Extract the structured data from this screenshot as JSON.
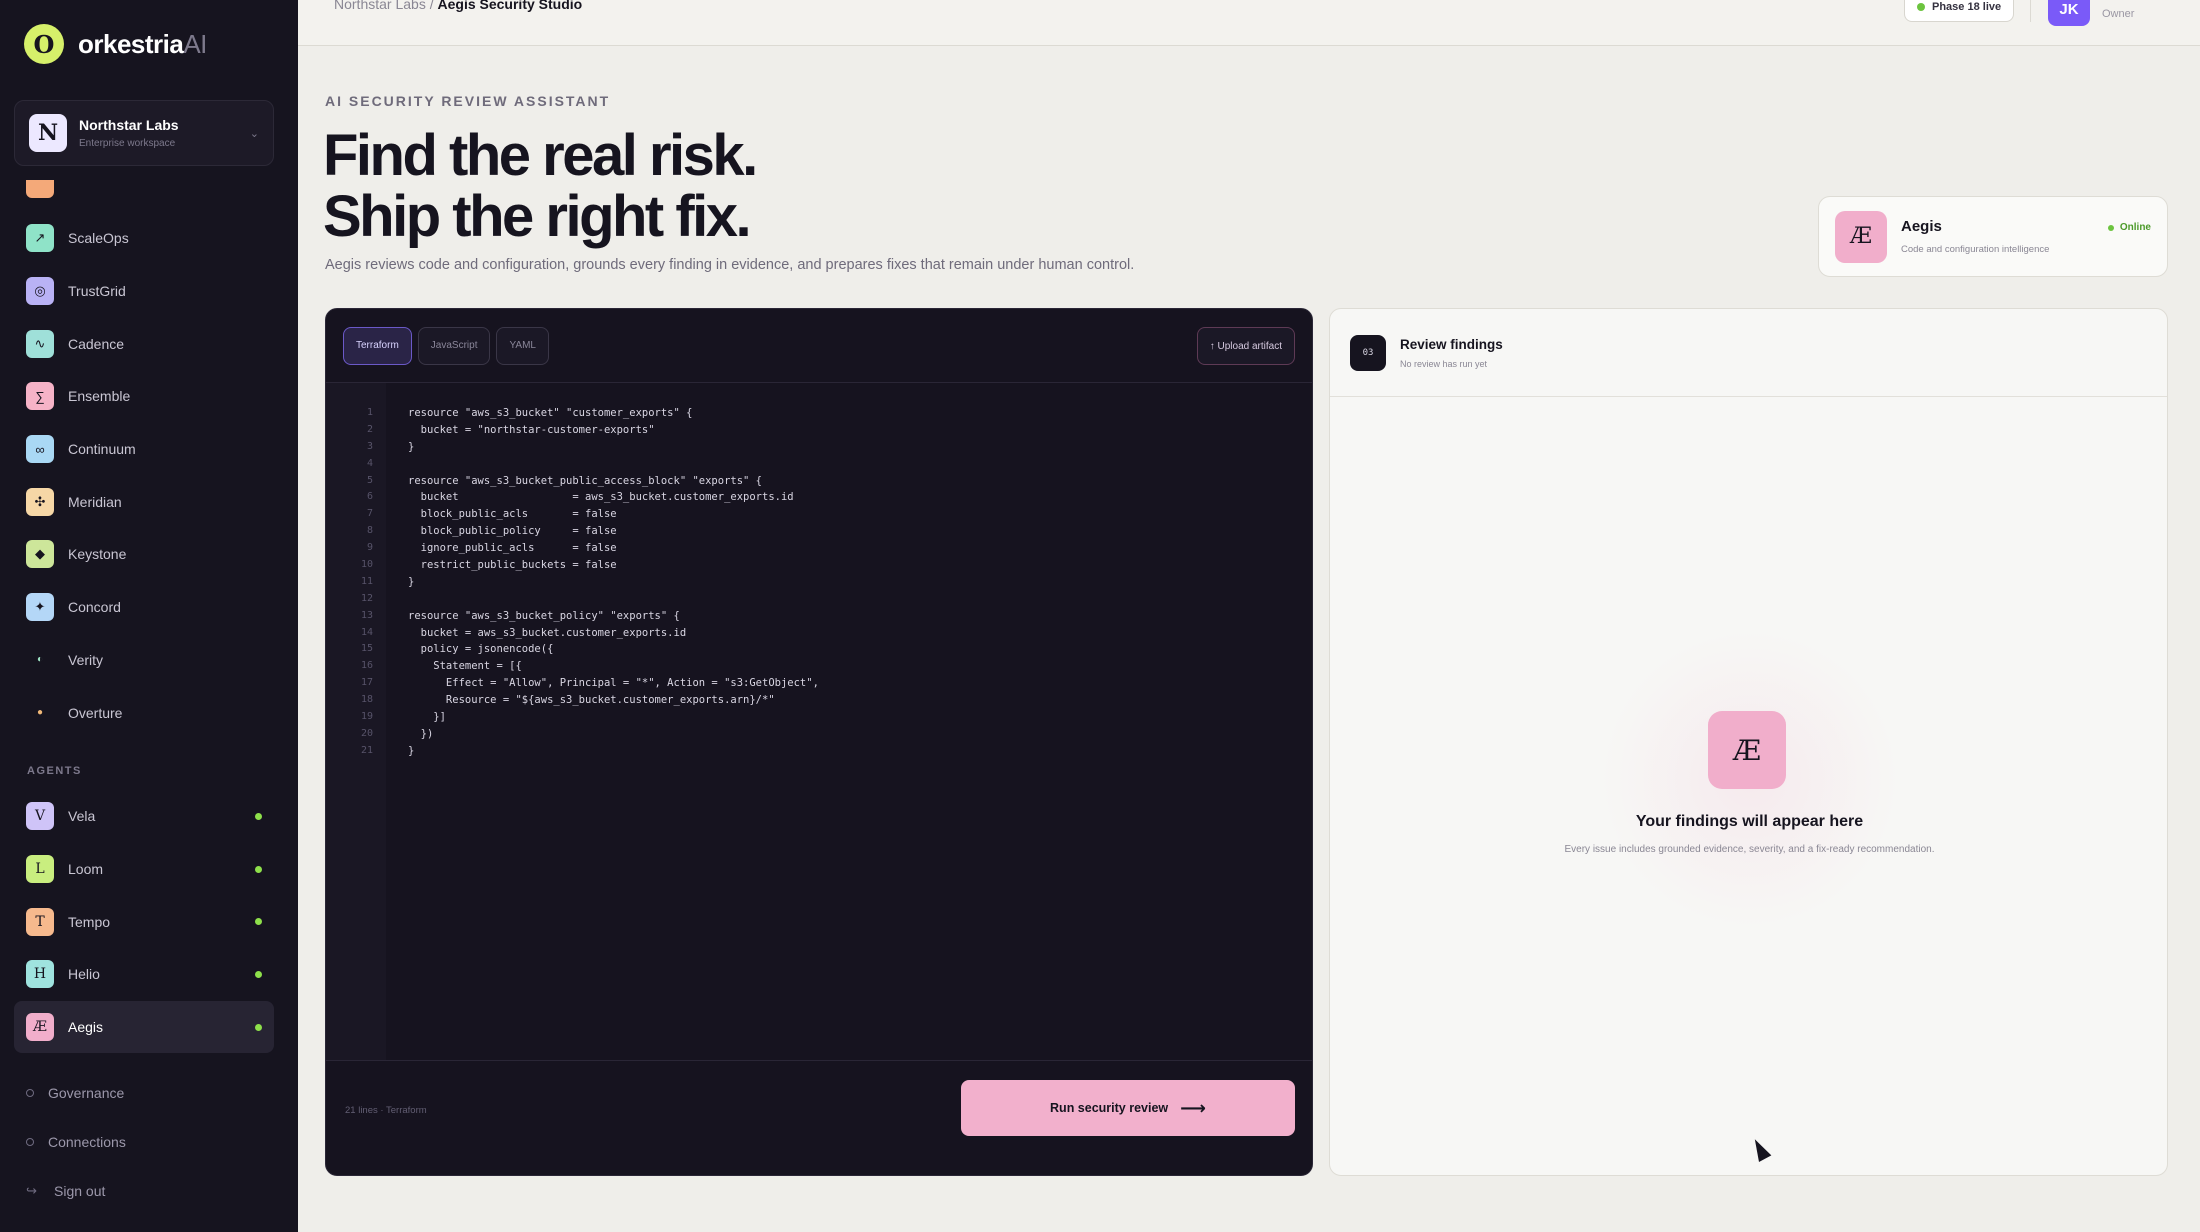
{
  "brand": {
    "mark": "O",
    "name": "orkestria",
    "suffix": "AI"
  },
  "workspace": {
    "avatar": "N",
    "name": "Northstar Labs",
    "subtitle": "Enterprise workspace"
  },
  "nav": [
    {
      "label": "ScaleOps",
      "glyph": "↗",
      "color": "#8fe3c8"
    },
    {
      "label": "TrustGrid",
      "glyph": "◎",
      "color": "#b9b2f5"
    },
    {
      "label": "Cadence",
      "glyph": "∿",
      "color": "#9fe0d9"
    },
    {
      "label": "Ensemble",
      "glyph": "∑",
      "color": "#f6b3c7"
    },
    {
      "label": "Continuum",
      "glyph": "∞",
      "color": "#a9d8f4"
    },
    {
      "label": "Meridian",
      "glyph": "✣",
      "color": "#f6d7a6"
    },
    {
      "label": "Keystone",
      "glyph": "◆",
      "color": "#cde69a"
    },
    {
      "label": "Concord",
      "glyph": "✦",
      "color": "#b4d7f7"
    },
    {
      "label": "Verity",
      "glyph": "◐",
      "color": "#9ee3c4"
    },
    {
      "label": "Overture",
      "glyph": "●",
      "color": "#f0b878"
    }
  ],
  "agents_label": "AGENTS",
  "agents": [
    {
      "label": "Vela",
      "glyph": "V",
      "color": "#cfc4f8",
      "active": false
    },
    {
      "label": "Loom",
      "glyph": "L",
      "color": "#c9ee7f",
      "active": false
    },
    {
      "label": "Tempo",
      "glyph": "T",
      "color": "#f6b98d",
      "active": false
    },
    {
      "label": "Helio",
      "glyph": "H",
      "color": "#9fe3df",
      "active": false
    },
    {
      "label": "Aegis",
      "glyph": "Æ",
      "color": "#f1aecb",
      "active": true
    }
  ],
  "bottom_links": [
    {
      "label": "Governance",
      "icon": "circle-icon"
    },
    {
      "label": "Connections",
      "icon": "circle-icon"
    },
    {
      "label": "Sign out",
      "icon": "sign-out-icon"
    }
  ],
  "topbar": {
    "breadcrumb_parent": "Northstar Labs /",
    "breadcrumb_current": "Aegis Security Studio",
    "phase_badge": "Phase 18 live",
    "user_initials": "JK",
    "user_role": "Owner"
  },
  "hero": {
    "eyebrow": "AI SECURITY REVIEW ASSISTANT",
    "title_line1": "Find the real risk.",
    "title_line2": "Ship the right fix.",
    "description": "Aegis reviews code and configuration, grounds every finding in evidence, and prepares fixes that remain under human control."
  },
  "agent_card": {
    "icon": "Æ",
    "name": "Aegis",
    "subtitle": "Code and configuration intelligence",
    "status": "Online"
  },
  "editor": {
    "tabs": [
      "Terraform",
      "JavaScript",
      "YAML"
    ],
    "active_tab": "Terraform",
    "upload_label": "↑ Upload artifact",
    "lines": [
      "resource \"aws_s3_bucket\" \"customer_exports\" {",
      "  bucket = \"northstar-customer-exports\"",
      "}",
      "",
      "resource \"aws_s3_bucket_public_access_block\" \"exports\" {",
      "  bucket                  = aws_s3_bucket.customer_exports.id",
      "  block_public_acls       = false",
      "  block_public_policy     = false",
      "  ignore_public_acls      = false",
      "  restrict_public_buckets = false",
      "}",
      "",
      "resource \"aws_s3_bucket_policy\" \"exports\" {",
      "  bucket = aws_s3_bucket.customer_exports.id",
      "  policy = jsonencode({",
      "    Statement = [{",
      "      Effect = \"Allow\", Principal = \"*\", Action = \"s3:GetObject\",",
      "      Resource = \"${aws_s3_bucket.customer_exports.arn}/*\"",
      "    }]",
      "  })",
      "}"
    ],
    "footer_meta": "21 lines · Terraform",
    "run_label": "Run security review",
    "run_arrow": "⟶"
  },
  "findings": {
    "badge": "03",
    "title": "Review findings",
    "subtitle": "No review has run yet",
    "empty_icon": "Æ",
    "empty_title": "Your findings will appear here",
    "empty_description": "Every issue includes grounded evidence, severity, and a fix-ready recommendation."
  }
}
